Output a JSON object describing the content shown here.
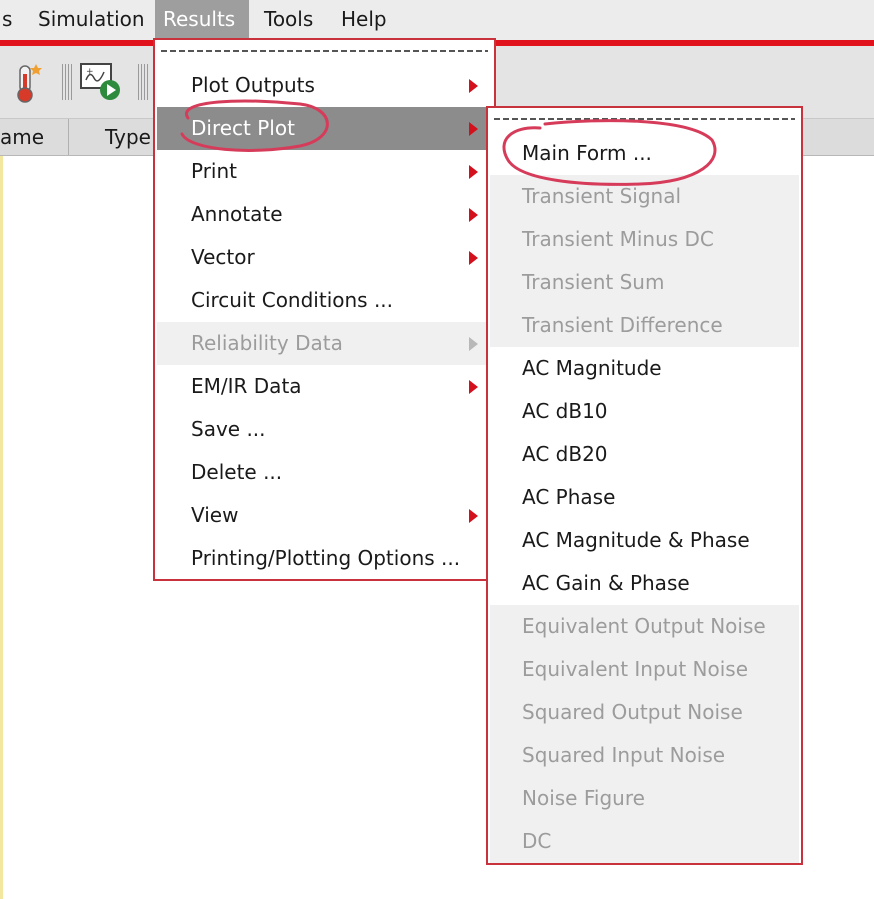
{
  "menubar": {
    "items": [
      {
        "label": "s"
      },
      {
        "label": "Simulation"
      },
      {
        "label": "Results"
      },
      {
        "label": "Tools"
      },
      {
        "label": "Help"
      }
    ]
  },
  "columns": {
    "name": "ame",
    "type": "Type"
  },
  "results_menu": {
    "items": [
      {
        "label": "Plot Outputs",
        "submenu": true
      },
      {
        "label": "Direct Plot",
        "submenu": true,
        "state": "highlighted"
      },
      {
        "label": "Print",
        "submenu": true
      },
      {
        "label": "Annotate",
        "submenu": true
      },
      {
        "label": "Vector",
        "submenu": true
      },
      {
        "label": "Circuit Conditions ..."
      },
      {
        "label": "Reliability Data",
        "submenu": true,
        "state": "disabled"
      },
      {
        "label": "EM/IR Data",
        "submenu": true
      },
      {
        "label": "Save ..."
      },
      {
        "label": "Delete ..."
      },
      {
        "label": "View",
        "submenu": true
      },
      {
        "label": "Printing/Plotting Options ..."
      }
    ]
  },
  "direct_plot_menu": {
    "items": [
      {
        "label": "Main Form ..."
      },
      {
        "label": "Transient Signal",
        "state": "disabled"
      },
      {
        "label": "Transient Minus DC",
        "state": "disabled"
      },
      {
        "label": "Transient Sum",
        "state": "disabled"
      },
      {
        "label": "Transient Difference",
        "state": "disabled"
      },
      {
        "label": "AC Magnitude"
      },
      {
        "label": "AC dB10"
      },
      {
        "label": "AC dB20"
      },
      {
        "label": "AC Phase"
      },
      {
        "label": "AC Magnitude & Phase"
      },
      {
        "label": "AC Gain & Phase"
      },
      {
        "label": "Equivalent Output Noise",
        "state": "disabled"
      },
      {
        "label": "Equivalent Input Noise",
        "state": "disabled"
      },
      {
        "label": "Squared Output Noise",
        "state": "disabled"
      },
      {
        "label": "Squared Input Noise",
        "state": "disabled"
      },
      {
        "label": "Noise Figure",
        "state": "disabled"
      },
      {
        "label": "DC",
        "state": "disabled"
      }
    ]
  },
  "colors": {
    "accent_red": "#e0131c",
    "menu_border": "#c8323c",
    "annotation": "#d63c5a",
    "highlight": "#8c8c8c"
  }
}
